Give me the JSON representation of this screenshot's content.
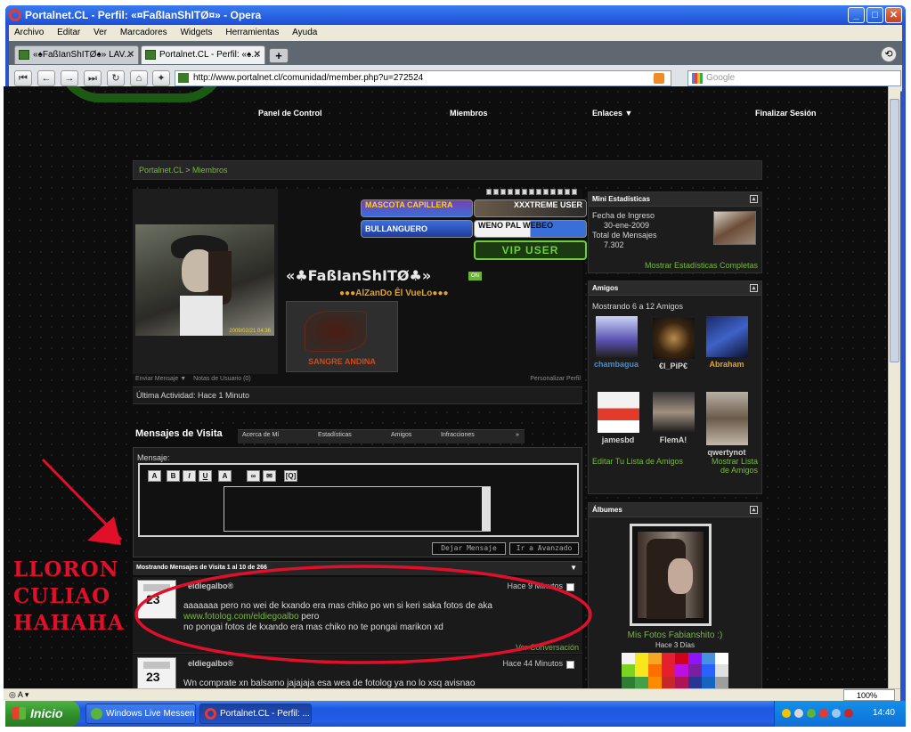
{
  "window": {
    "title": "Portalnet.CL - Perfil: «¤FaßIanShITØ¤» - Opera"
  },
  "menu": [
    "Archivo",
    "Editar",
    "Ver",
    "Marcadores",
    "Widgets",
    "Herramientas",
    "Ayuda"
  ],
  "tabs": [
    {
      "label": "«♠FaßIanShITØ♠» LAV..."
    },
    {
      "label": "Portalnet.CL - Perfil: «♠..."
    }
  ],
  "address": {
    "url": "http://www.portalnet.cl/comunidad/member.php?u=272524",
    "search_placeholder": "Google"
  },
  "topnav": [
    "Panel de Control",
    "Miembros",
    "Enlaces ▼",
    "Finalizar Sesión"
  ],
  "breadcrumb": {
    "home": "Portalnet.CL",
    "sep": ">",
    "current": "Miembros"
  },
  "profile": {
    "username": "«♣FaßIanShITØ♣»",
    "online_badge": "ON",
    "user_title": "●●●AlZanDo Êl VueLo●●●",
    "avatar_timestamp": "2009/02/21 04:36",
    "sangre_label": "SANGRE ANDINA",
    "badges": {
      "mascota": "MASCOTA CAPILLERA",
      "xxxtreme": "XXXTREME USER",
      "bullanguero": "BULLANGUERO",
      "weno": "WENO PAL WEBEO",
      "vip": "VIP USER"
    },
    "send_message": "Enviar Mensaje ▼",
    "user_notes": "Notas de Usuario (0)",
    "customize": "Personalizar Perfil",
    "last_activity": "Última Actividad: Hace 1 Minuto"
  },
  "profile_tabs": {
    "active": "Mensajes de Visita",
    "items": [
      "Acerca de Mí",
      "Estadísticas",
      "Amigos",
      "Infracciones",
      "»"
    ]
  },
  "message_form": {
    "label": "Mensaje:",
    "toolbar": [
      "A",
      "B",
      "I",
      "U",
      "A",
      "∞",
      "✉",
      "[Q]"
    ],
    "submit": "Dejar Mensaje",
    "advanced": "Ir a Avanzado"
  },
  "showing": "Mostrando Mensajes de Visita 1 al 10 de 266",
  "visitor_messages": [
    {
      "avatar_number": "23",
      "author": "eldiegalbo®",
      "time": "Hace 9 Minutos",
      "line1": "aaaaaaa pero no wei de kxando era mas chiko po wn si keri saka fotos de aka",
      "link": "www.fotolog.com/eldiegoalbo",
      "line2_suffix": " pero",
      "line3": "no pongai fotos de kxando era mas chiko no te pongai marikon xd",
      "conversation": "Ver Conversación"
    },
    {
      "avatar_number": "23",
      "author": "eldiegalbo®",
      "time": "Hace 44 Minutos",
      "line1": "Wn comprate xn balsamo jajajaja esa wea de fotolog ya no lo xsq avisnao"
    }
  ],
  "mini_stats": {
    "title": "Mini Estadísticas",
    "join_label": "Fecha de Ingreso",
    "join_date": "30-ene-2009",
    "posts_label": "Total de Mensajes",
    "posts": "7.302",
    "full_stats": "Mostrar Estadísticas Completas"
  },
  "friends": {
    "title": "Amigos",
    "showing": "Mostrando 6 a 12 Amigos",
    "list": [
      {
        "name": "chambagua",
        "color": "#3b8fd8"
      },
      {
        "name": "€l_PiP€",
        "color": "#d4d4d4"
      },
      {
        "name": "Abraham",
        "color": "#e0a22b"
      },
      {
        "name": "jamesbd",
        "color": "#d4d4d4"
      },
      {
        "name": "FlemA!",
        "color": "#d4d4d4"
      },
      {
        "name": "qwertynot",
        "color": "#d4d4d4"
      }
    ],
    "edit_link": "Editar Tu Lista de Amigos",
    "show_link": "Mostrar Lista de Amigos"
  },
  "albums": {
    "title": "Álbumes",
    "album_title": "Mis Fotos Fabianshito :)",
    "album_date": "Hace 3 Días"
  },
  "annotation": [
    "LLORON",
    "CULIAO",
    "HAHAHA"
  ],
  "statusbar": {
    "zoom": "100%"
  },
  "taskbar": {
    "start": "Inicio",
    "tasks": [
      "Windows Live Messen...",
      "Portalnet.CL - Perfil: ..."
    ],
    "clock": "14:40"
  },
  "colors": {
    "accent_green": "#78b83c",
    "annotation_red": "#e0102a",
    "page_bg": "#0d0d0d"
  }
}
